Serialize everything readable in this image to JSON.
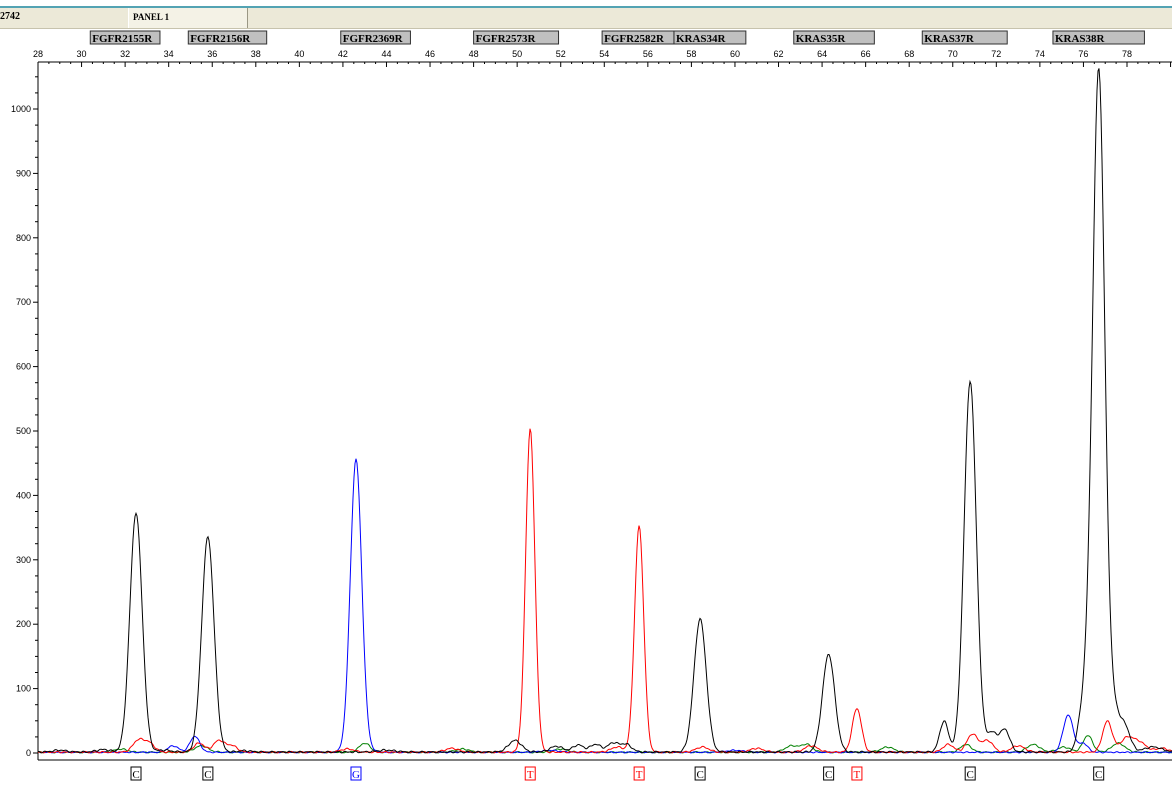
{
  "header": {
    "sample_id": "2742",
    "panel_label": "PANEL 1"
  },
  "colors": {
    "black_trace": "#000000",
    "blue_trace": "#0000ff",
    "red_trace": "#ff0000",
    "green_trace": "#008000",
    "marker_box": "#c0c0c0",
    "header_bg": "#ece9d8",
    "accent_line": "#53a3b3"
  },
  "chart_data": {
    "type": "line",
    "title": "",
    "xlabel": "",
    "ylabel": "",
    "xlim": [
      28,
      80
    ],
    "ylim": [
      0,
      1080
    ],
    "x_ticks": [
      28,
      30,
      32,
      34,
      36,
      38,
      40,
      42,
      44,
      46,
      48,
      50,
      52,
      54,
      56,
      58,
      60,
      62,
      64,
      66,
      68,
      70,
      72,
      74,
      76,
      78
    ],
    "y_ticks": [
      0,
      100,
      200,
      300,
      400,
      500,
      600,
      700,
      800,
      900,
      1000
    ],
    "grid": false,
    "markers": [
      {
        "name": "FGFR2155R",
        "start": 30.4,
        "end": 33.6
      },
      {
        "name": "FGFR2156R",
        "start": 34.9,
        "end": 38.5
      },
      {
        "name": "FGFR2369R",
        "start": 41.9,
        "end": 45.1
      },
      {
        "name": "FGFR2573R",
        "start": 48.0,
        "end": 51.9
      },
      {
        "name": "FGFR2582R",
        "start": 53.9,
        "end": 57.2
      },
      {
        "name": "KRAS34R",
        "start": 57.2,
        "end": 60.5
      },
      {
        "name": "KRAS35R",
        "start": 62.7,
        "end": 66.4
      },
      {
        "name": "KRAS37R",
        "start": 68.6,
        "end": 72.5
      },
      {
        "name": "KRAS38R",
        "start": 74.6,
        "end": 78.8
      }
    ],
    "series": [
      {
        "color": "black",
        "peaks": [
          [
            32.5,
            372
          ],
          [
            35.8,
            335
          ],
          [
            58.4,
            207
          ],
          [
            64.3,
            152
          ],
          [
            70.8,
            577
          ],
          [
            76.7,
            1060
          ]
        ]
      },
      {
        "color": "blue",
        "peaks": [
          [
            42.6,
            453
          ]
        ]
      },
      {
        "color": "red",
        "peaks": [
          [
            50.6,
            503
          ],
          [
            55.6,
            352
          ],
          [
            65.6,
            68
          ]
        ]
      },
      {
        "color": "green",
        "peaks": []
      }
    ],
    "base_calls": [
      {
        "x": 32.5,
        "base": "C",
        "color": "black"
      },
      {
        "x": 35.8,
        "base": "C",
        "color": "black"
      },
      {
        "x": 42.6,
        "base": "G",
        "color": "blue"
      },
      {
        "x": 50.6,
        "base": "T",
        "color": "red"
      },
      {
        "x": 55.6,
        "base": "T",
        "color": "red"
      },
      {
        "x": 58.4,
        "base": "C",
        "color": "black"
      },
      {
        "x": 64.3,
        "base": "C",
        "color": "black"
      },
      {
        "x": 65.6,
        "base": "T",
        "color": "red"
      },
      {
        "x": 70.8,
        "base": "C",
        "color": "black"
      },
      {
        "x": 76.7,
        "base": "C",
        "color": "black"
      }
    ]
  }
}
